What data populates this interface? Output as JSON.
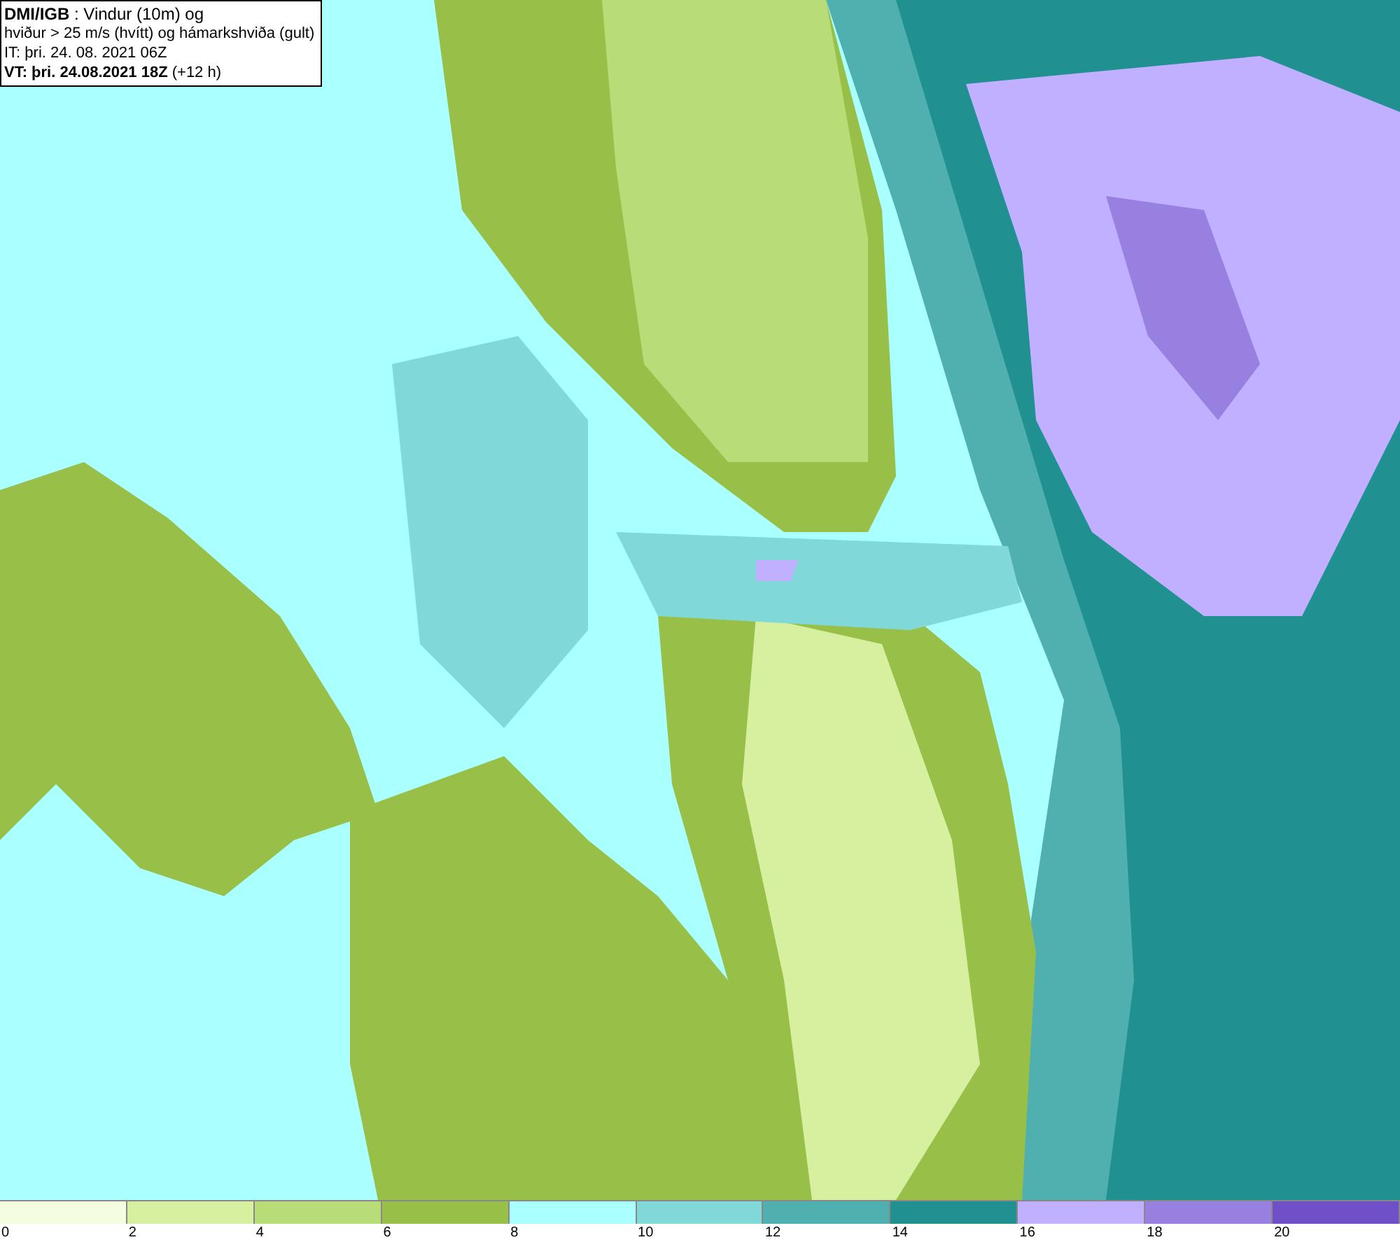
{
  "header": {
    "lines": [
      "**DMI/IGB** : Vindur (10m) og",
      "hviður > 25 m/s (hvítt) og hámarkshviða (gult)",
      "IT: þri. 24. 08. 2021 06Z",
      "**VT: þri. 24.08.2021 18Z** (+12 h)"
    ]
  },
  "legend": {
    "bins": [
      {
        "color": "#f5fde0",
        "label": "0"
      },
      {
        "color": "#d6f0a0",
        "label": "2"
      },
      {
        "color": "#b8dc78",
        "label": "4"
      },
      {
        "color": "#98c048",
        "label": "6"
      },
      {
        "color": "#aaffff",
        "label": "8"
      },
      {
        "color": "#80d8d8",
        "label": "10"
      },
      {
        "color": "#50b0b0",
        "label": "12"
      },
      {
        "color": "#209090",
        "label": "14"
      },
      {
        "color": "#c0b0ff",
        "label": "16"
      },
      {
        "color": "#9880e0",
        "label": "18"
      },
      {
        "color": "#7050c8",
        "label": "20"
      }
    ]
  }
}
